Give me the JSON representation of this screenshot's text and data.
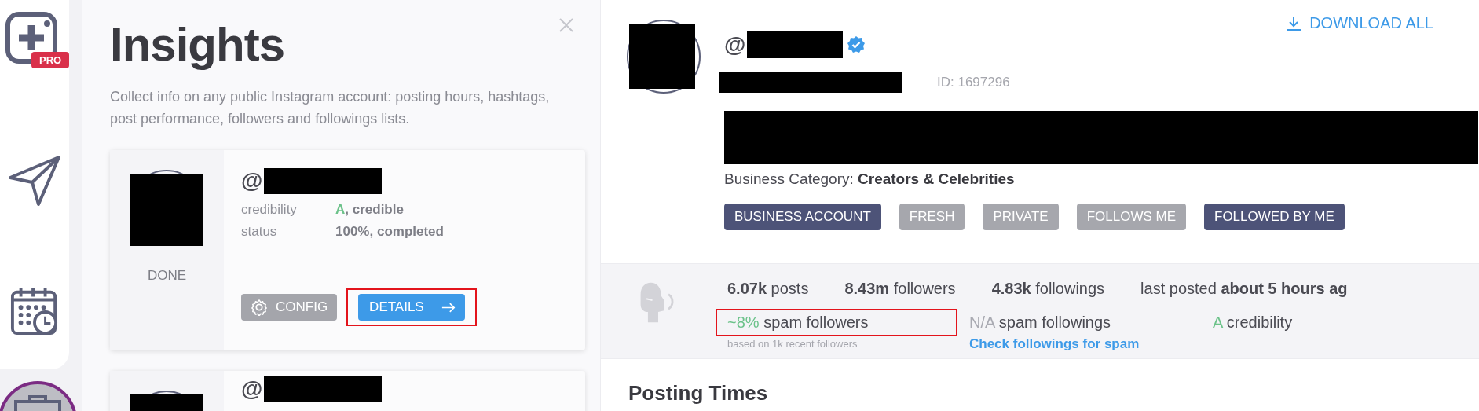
{
  "rail": {
    "badge": "PRO"
  },
  "panel": {
    "title": "Insights",
    "description": "Collect info on any public Instagram account: posting hours, hashtags, post performance, followers and followings lists.",
    "cards": [
      {
        "at": "@",
        "state": "DONE",
        "rows": [
          {
            "label": "credibility",
            "grade": "A",
            "value": ", credible"
          },
          {
            "label": "status",
            "grade": "",
            "value": "100%, completed"
          }
        ],
        "config": "CONFIG",
        "details": {
          "label": "DETAILS",
          "highlighted": true
        }
      },
      {
        "at": "@"
      }
    ]
  },
  "profile": {
    "download": "DOWNLOAD ALL",
    "at": "@",
    "verified": true,
    "id": "ID: 1697296",
    "category_label": "Business Category:",
    "category": "Creators & Celebrities",
    "tags": [
      {
        "label": "BUSINESS ACCOUNT",
        "on": true
      },
      {
        "label": "FRESH",
        "on": false
      },
      {
        "label": "PRIVATE",
        "on": false
      },
      {
        "label": "FOLLOWS ME",
        "on": false
      },
      {
        "label": "FOLLOWED BY ME",
        "on": true
      }
    ]
  },
  "stats": {
    "counts": [
      {
        "value": "6.07k",
        "label": "posts"
      },
      {
        "value": "8.43m",
        "label": "followers"
      },
      {
        "value": "4.83k",
        "label": "followings"
      },
      {
        "label": "last posted",
        "value": "about 5 hours ag",
        "kind": "suffix"
      }
    ],
    "spam": [
      {
        "value": "~8%",
        "label": "spam followers",
        "color": "#6cc28a",
        "note": "based on 1k recent followers",
        "highlighted": true
      },
      {
        "value": "N/A",
        "label": "spam followings",
        "color": "#a9aab2",
        "link": "Check followings for spam",
        "highlighted": false
      },
      {
        "value": "A",
        "label": "credibility",
        "color": "#6cc28a",
        "highlighted": false
      }
    ]
  },
  "section": {
    "title": "Posting Times"
  }
}
